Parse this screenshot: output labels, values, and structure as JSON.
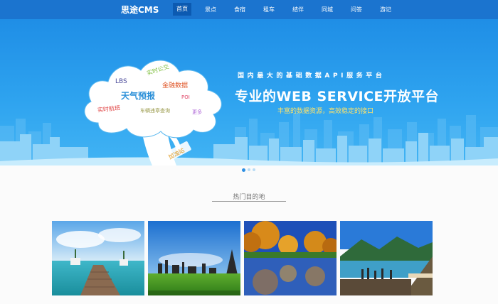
{
  "nav": {
    "brand": "思途CMS",
    "items": [
      {
        "label": "首页",
        "active": true
      },
      {
        "label": "景点",
        "active": false
      },
      {
        "label": "食宿",
        "active": false
      },
      {
        "label": "租车",
        "active": false
      },
      {
        "label": "结伴",
        "active": false
      },
      {
        "label": "同城",
        "active": false
      },
      {
        "label": "问答",
        "active": false
      },
      {
        "label": "游记",
        "active": false
      }
    ]
  },
  "banner": {
    "headline": "国内最大的基础数据API服务平台",
    "title": "专业的WEB SERVICE开放平台",
    "subtitle": "丰富的数据资源，高效稳定的接口",
    "cloud_words": {
      "w1": "实时公交",
      "w2": "LBS",
      "w3": "金融数据",
      "w4": "天气预报",
      "w5": "POI",
      "w6": "实时航班",
      "w7": "车辆违章查询",
      "w8": "更多"
    },
    "trunk_label": "加油站",
    "colors": {
      "sky": "#1f8ee6",
      "cloud": "#ffffff",
      "city": "#8fd3f8",
      "subtitle": "#ffe36a"
    }
  },
  "carousel": {
    "count": 3,
    "active": 0
  },
  "destinations": {
    "title": "热门目的地",
    "photos": [
      {
        "name": "beach-pier-photo"
      },
      {
        "name": "city-meadow-photo"
      },
      {
        "name": "autumn-lake-photo"
      },
      {
        "name": "mountain-lake-photo"
      }
    ]
  }
}
